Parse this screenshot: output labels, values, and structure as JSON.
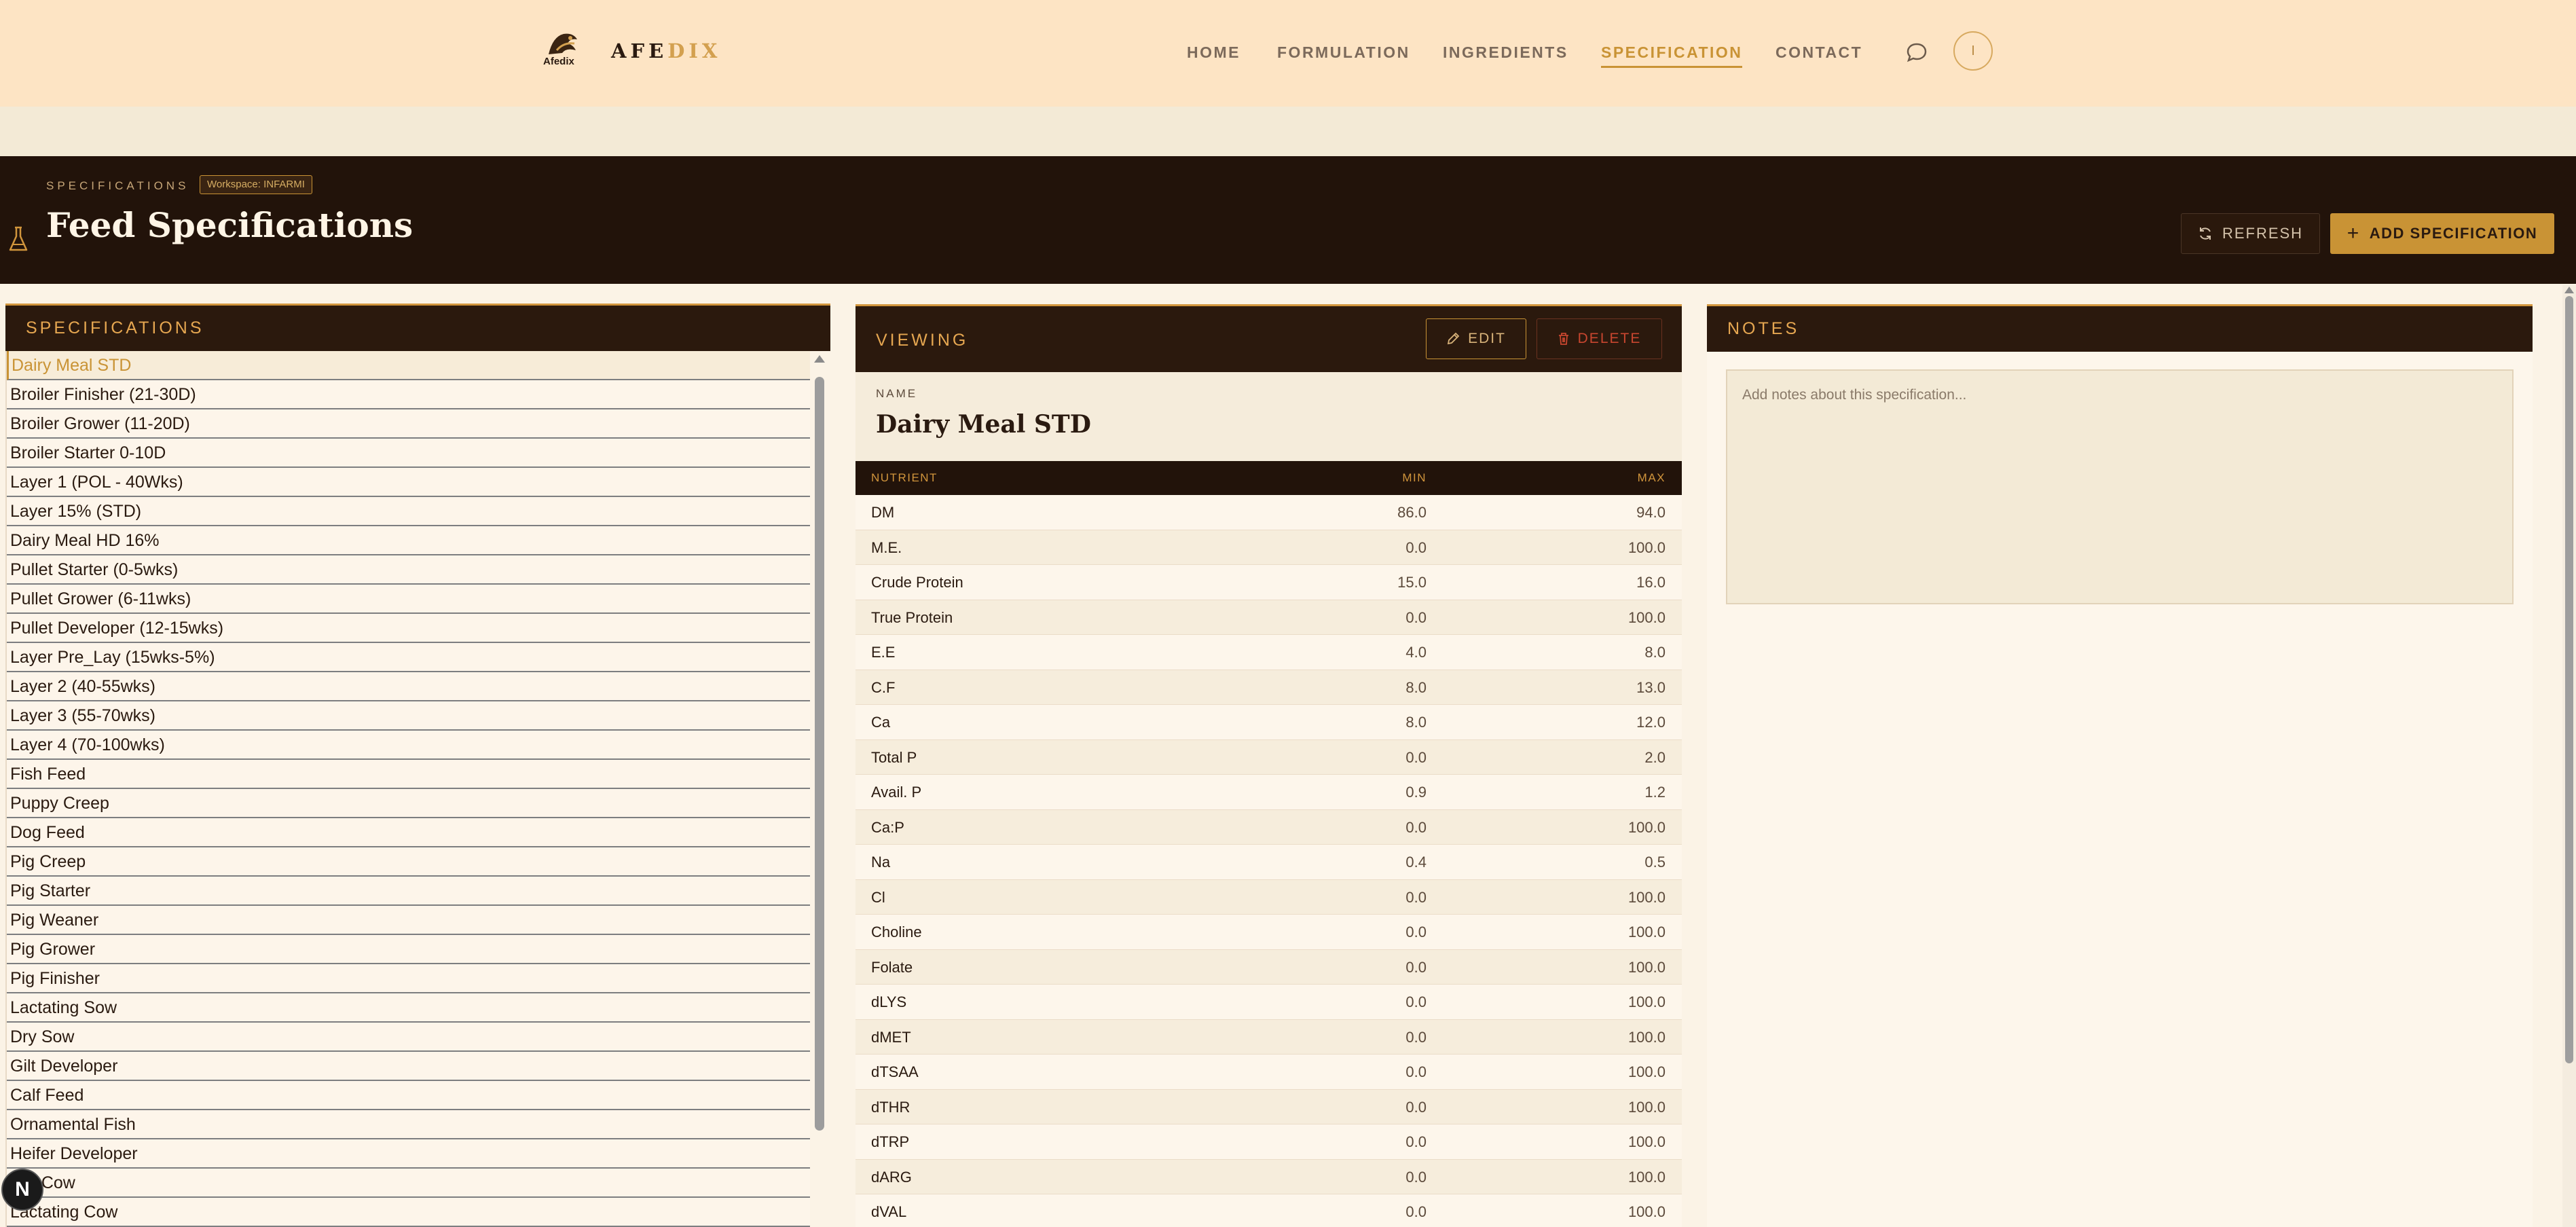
{
  "nav": {
    "logo_text": "Afedix",
    "brand_a": "AFE",
    "brand_b": "DIX",
    "links": [
      "HOME",
      "FORMULATION",
      "INGREDIENTS",
      "SPECIFICATION",
      "CONTACT"
    ],
    "active": "SPECIFICATION",
    "avatar_initial": "I"
  },
  "hero": {
    "eyebrow": "SPECIFICATIONS",
    "workspace": "Workspace: INFARMI",
    "title": "Feed Specifications",
    "refresh_label": "REFRESH",
    "add_label": "ADD SPECIFICATION"
  },
  "list": {
    "header": "SPECIFICATIONS",
    "items": [
      "Dairy Meal STD",
      "Broiler Finisher (21-30D)",
      "Broiler Grower (11-20D)",
      "Broiler Starter 0-10D",
      "Layer 1 (POL - 40Wks)",
      "Layer 15% (STD)",
      "Dairy Meal HD 16%",
      "Pullet Starter (0-5wks)",
      "Pullet Grower (6-11wks)",
      "Pullet Developer (12-15wks)",
      "Layer Pre_Lay (15wks-5%)",
      "Layer 2 (40-55wks)",
      "Layer 3 (55-70wks)",
      "Layer 4 (70-100wks)",
      "Fish Feed",
      "Puppy Creep",
      "Dog Feed",
      "Pig Creep",
      "Pig Starter",
      "Pig Weaner",
      "Pig Grower",
      "Pig Finisher",
      "Lactating Sow",
      "Dry Sow",
      "Gilt Developer",
      "Calf Feed",
      "Ornamental Fish",
      "Heifer Developer",
      "Dry Cow",
      "Lactating Cow"
    ]
  },
  "view": {
    "header": "VIEWING",
    "edit_label": "EDIT",
    "delete_label": "DELETE",
    "name_label": "NAME",
    "name_value": "Dairy Meal STD",
    "col_nutrient": "NUTRIENT",
    "col_min": "MIN",
    "col_max": "MAX",
    "rows": [
      {
        "n": "DM",
        "min": "86.0",
        "max": "94.0"
      },
      {
        "n": "M.E.",
        "min": "0.0",
        "max": "100.0"
      },
      {
        "n": "Crude Protein",
        "min": "15.0",
        "max": "16.0"
      },
      {
        "n": "True Protein",
        "min": "0.0",
        "max": "100.0"
      },
      {
        "n": "E.E",
        "min": "4.0",
        "max": "8.0"
      },
      {
        "n": "C.F",
        "min": "8.0",
        "max": "13.0"
      },
      {
        "n": "Ca",
        "min": "8.0",
        "max": "12.0"
      },
      {
        "n": "Total P",
        "min": "0.0",
        "max": "2.0"
      },
      {
        "n": "Avail. P",
        "min": "0.9",
        "max": "1.2"
      },
      {
        "n": "Ca:P",
        "min": "0.0",
        "max": "100.0"
      },
      {
        "n": "Na",
        "min": "0.4",
        "max": "0.5"
      },
      {
        "n": "Cl",
        "min": "0.0",
        "max": "100.0"
      },
      {
        "n": "Choline",
        "min": "0.0",
        "max": "100.0"
      },
      {
        "n": "Folate",
        "min": "0.0",
        "max": "100.0"
      },
      {
        "n": "dLYS",
        "min": "0.0",
        "max": "100.0"
      },
      {
        "n": "dMET",
        "min": "0.0",
        "max": "100.0"
      },
      {
        "n": "dTSAA",
        "min": "0.0",
        "max": "100.0"
      },
      {
        "n": "dTHR",
        "min": "0.0",
        "max": "100.0"
      },
      {
        "n": "dTRP",
        "min": "0.0",
        "max": "100.0"
      },
      {
        "n": "dARG",
        "min": "0.0",
        "max": "100.0"
      },
      {
        "n": "dVAL",
        "min": "0.0",
        "max": "100.0"
      }
    ]
  },
  "notes": {
    "header": "NOTES",
    "placeholder": "Add notes about this specification..."
  },
  "next_badge": "N",
  "colors": {
    "accent": "#c99335",
    "dark": "#22130a",
    "nav_bg": "#fde4c4",
    "danger": "#c8462f"
  }
}
